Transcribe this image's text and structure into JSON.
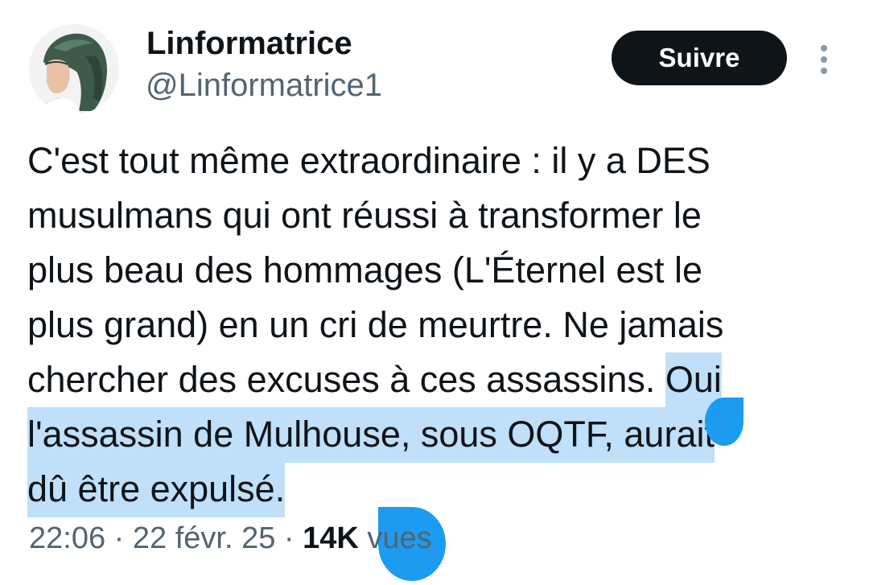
{
  "author": {
    "display_name": "Linformatrice",
    "handle": "@Linformatrice1",
    "avatar": "profile-photo-woman-headscarf"
  },
  "follow_button": {
    "label": "Suivre"
  },
  "more_menu": {
    "icon": "more-vertical-icon"
  },
  "tweet": {
    "lines": [
      "C'est tout même extraordinaire : il y a DES",
      "musulmans qui ont réussi à transformer le",
      "plus beau des hommages (L'Éternel est le",
      "plus grand) en un cri de meurtre. Ne jamais"
    ],
    "line5_plain": "chercher des excuses à ces assassins. ",
    "line5_selected": "Oui",
    "line6_selected": "l'assassin de Mulhouse, sous OQTF, aurait",
    "line7_selected": "dû être expulsé.",
    "selection_color": "#bfe0f8",
    "selection_handle_color": "#1d9bf0"
  },
  "meta": {
    "time": "22:06",
    "separator": " · ",
    "date": "22 févr. 25",
    "views_count": "14K",
    "views_label": " vues"
  },
  "colors": {
    "text": "#0f1419",
    "secondary": "#536471",
    "button_bg": "#0f1419",
    "button_text": "#ffffff"
  }
}
